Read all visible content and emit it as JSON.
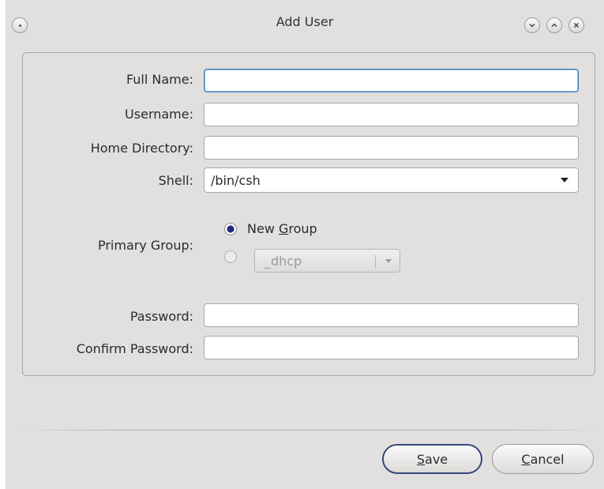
{
  "window": {
    "title": "Add User"
  },
  "titlebar": {
    "menu_icon": "window-menu-icon",
    "minimize_icon": "minimize-icon",
    "maximize_icon": "maximize-icon",
    "close_icon": "close-icon"
  },
  "form": {
    "full_name_label": "Full Name:",
    "full_name_value": "",
    "username_label": "Username:",
    "username_value": "",
    "home_directory_label": "Home Directory:",
    "home_directory_value": "",
    "shell_label": "Shell:",
    "shell_value": "/bin/csh",
    "primary_group_label": "Primary Group:",
    "new_group_option_prefix": "New ",
    "new_group_option_mnemonic": "G",
    "new_group_option_suffix": "roup",
    "new_group_selected": true,
    "existing_group_value": "_dhcp",
    "password_label": "Password:",
    "password_value": "",
    "confirm_password_label": "Confirm Password:",
    "confirm_password_value": ""
  },
  "buttons": {
    "save_mnemonic": "S",
    "save_rest": "ave",
    "cancel_mnemonic": "C",
    "cancel_rest": "ancel"
  },
  "colors": {
    "window_bg": "#e2e0de",
    "focus_border": "#3c7fbf",
    "default_button_border": "#34467d",
    "radio_checked": "#1d2a80"
  }
}
